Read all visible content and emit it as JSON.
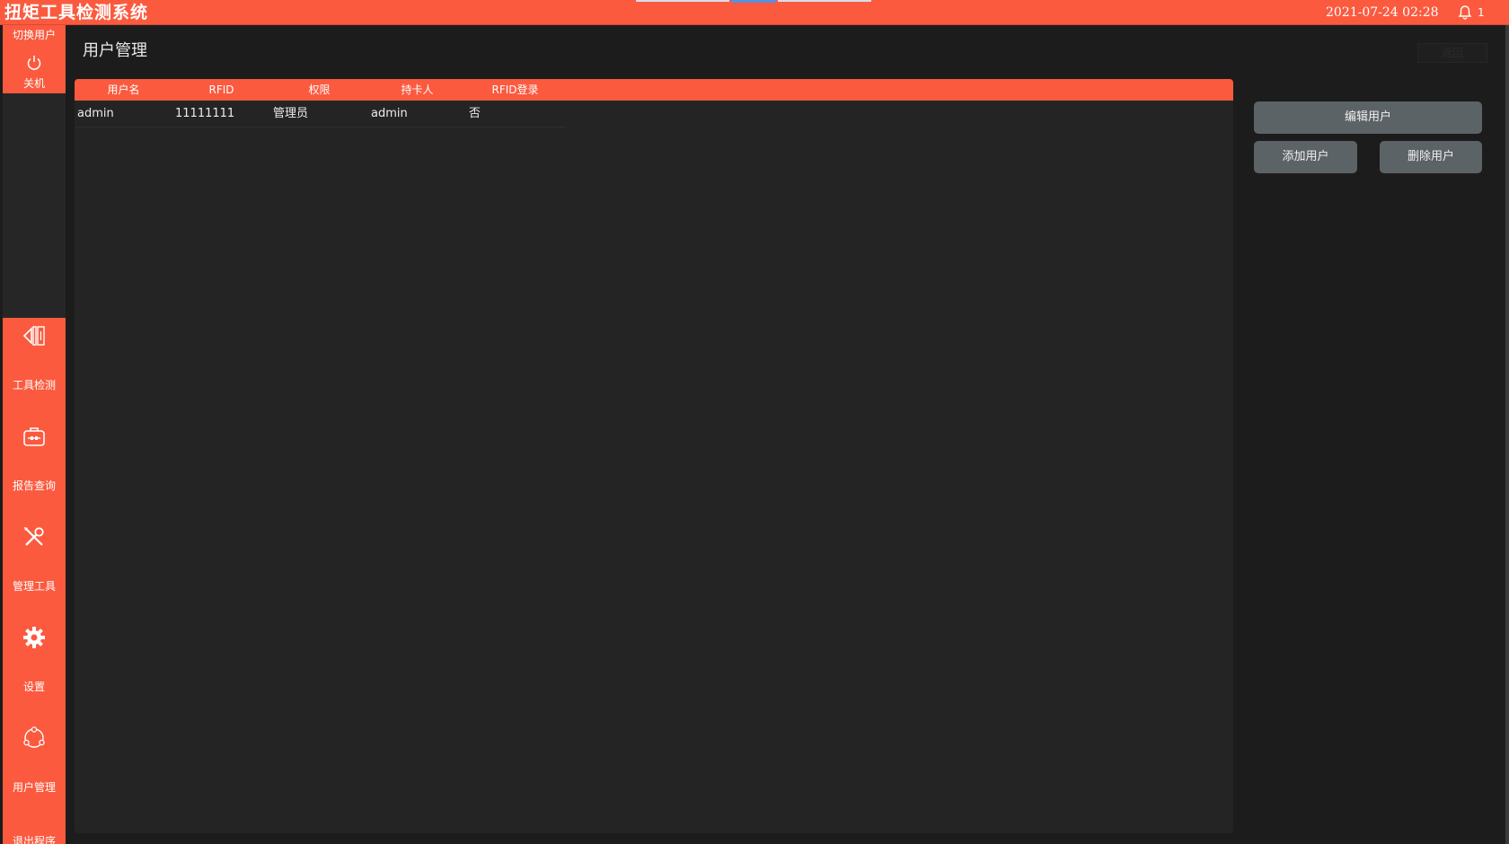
{
  "app": {
    "title": "扭矩工具检测系统",
    "datetime": "2021-07-24  02:28",
    "notification_count": "1"
  },
  "sidebar": {
    "switch_user": "切换用户",
    "shutdown": "关机",
    "items": [
      {
        "label": "工具检测",
        "icon": "tool-inspection-icon"
      },
      {
        "label": "报告查询",
        "icon": "toolbox-icon"
      },
      {
        "label": "管理工具",
        "icon": "wrench-screwdriver-icon"
      },
      {
        "label": "设置",
        "icon": "gear-icon"
      },
      {
        "label": "用户管理",
        "icon": "user-group-icon"
      }
    ],
    "exit": "退出程序"
  },
  "page": {
    "title": "用户管理",
    "top_right_button": "返回"
  },
  "table": {
    "columns": [
      "用户名",
      "RFID",
      "权限",
      "持卡人",
      "RFID登录"
    ],
    "rows": [
      [
        "admin",
        "11111111",
        "管理员",
        "admin",
        "否"
      ]
    ]
  },
  "actions": {
    "edit": "编辑用户",
    "add": "添加用户",
    "delete": "删除用户"
  },
  "colors": {
    "accent": "#fb5a3f",
    "background": "#1c1c1c",
    "panel": "#242424",
    "button": "#5c6366"
  }
}
